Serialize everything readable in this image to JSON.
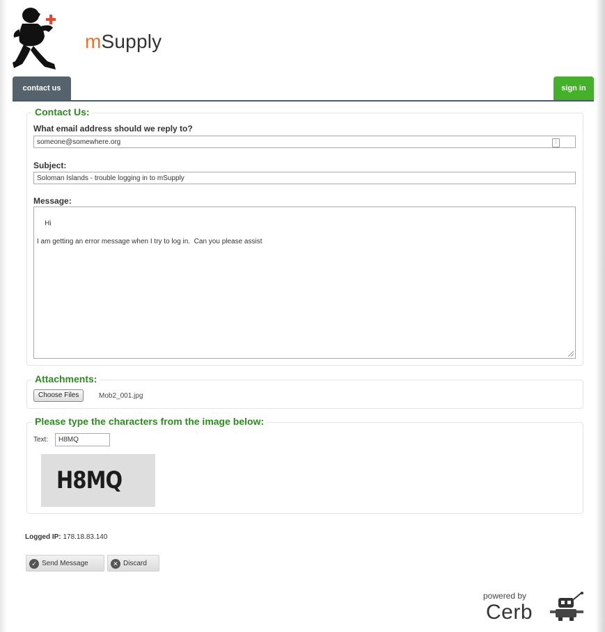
{
  "header": {
    "brand_prefix": "m",
    "brand_suffix": "Supply"
  },
  "nav": {
    "contact_tab": "contact us",
    "signin_button": "sign in"
  },
  "contact": {
    "legend": "Contact Us:",
    "email_label": "What email address should we reply to?",
    "email_value": "someone@somewhere.org",
    "subject_label": "Subject:",
    "subject_value": "Soloman Islands - trouble logging in to mSupply",
    "message_label": "Message:",
    "message_value": "Hi\n\nI am getting an error message when I try to log in.  Can you please assist"
  },
  "attachments": {
    "legend": "Attachments:",
    "choose_label": "Choose Files",
    "filename": "Mob2_001.jpg"
  },
  "captcha": {
    "legend": "Please type the characters from the image below:",
    "text_label": "Text:",
    "text_value": "H8MQ",
    "image_text": "H8MQ"
  },
  "footer": {
    "logged_ip_label": "Logged IP:",
    "logged_ip_value": "178.18.83.140",
    "send_label": "Send Message",
    "discard_label": "Discard",
    "powered_by": "powered by",
    "cerb": "Cerb"
  },
  "colors": {
    "accent_green": "#2e8b20",
    "signin_green": "#45b02a",
    "tab_slate": "#56636d",
    "brand_orange": "#e8732c"
  }
}
